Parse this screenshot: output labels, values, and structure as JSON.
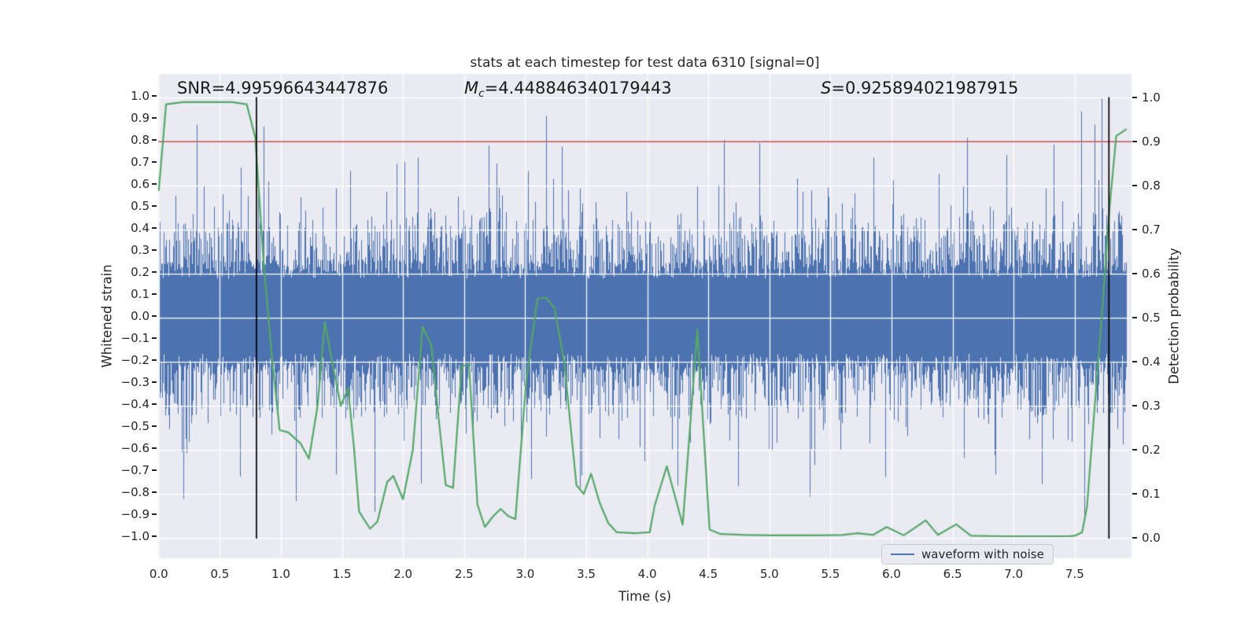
{
  "figure": {
    "title": "stats at each timestep for test data 6310 [signal=0]",
    "annotations": {
      "snr": "SNR=4.99596643447876",
      "mc_symbol": "M",
      "mc_sub": "c",
      "mc_value": "=4.448846340179443",
      "s_symbol": "S",
      "s_value": "=0.925894021987915"
    },
    "legend": {
      "label": "waveform with noise"
    }
  },
  "chart_data": {
    "type": "line",
    "title": "stats at each timestep for test data 6310 [signal=0]",
    "xlabel": "Time (s)",
    "ylabel_left": "Whitened strain",
    "ylabel_right": "Detection probability",
    "xlim": [
      -0.005,
      7.965
    ],
    "ylim_left": [
      -1.1,
      1.1
    ],
    "ylim_right": [
      -0.046,
      1.054
    ],
    "background": "#eaeaf2",
    "grid": {
      "color": "#ffffff",
      "x_step_s": 0.5,
      "y_right_step": 0.1
    },
    "xticks": [
      {
        "v": 0.0,
        "label": "0.0"
      },
      {
        "v": 0.5,
        "label": "0.5"
      },
      {
        "v": 1.0,
        "label": "1.0"
      },
      {
        "v": 1.5,
        "label": "1.5"
      },
      {
        "v": 2.0,
        "label": "2.0"
      },
      {
        "v": 2.5,
        "label": "2.5"
      },
      {
        "v": 3.0,
        "label": "3.0"
      },
      {
        "v": 3.5,
        "label": "3.5"
      },
      {
        "v": 4.0,
        "label": "4.0"
      },
      {
        "v": 4.5,
        "label": "4.5"
      },
      {
        "v": 5.0,
        "label": "5.0"
      },
      {
        "v": 5.5,
        "label": "5.5"
      },
      {
        "v": 6.0,
        "label": "6.0"
      },
      {
        "v": 6.5,
        "label": "6.5"
      },
      {
        "v": 7.0,
        "label": "7.0"
      },
      {
        "v": 7.5,
        "label": "7.5"
      }
    ],
    "yticks_left": [
      {
        "v": 1.0,
        "label": "1.0"
      },
      {
        "v": 0.9,
        "label": "0.9"
      },
      {
        "v": 0.8,
        "label": "0.8"
      },
      {
        "v": 0.7,
        "label": "0.7"
      },
      {
        "v": 0.6,
        "label": "0.6"
      },
      {
        "v": 0.5,
        "label": "0.5"
      },
      {
        "v": 0.4,
        "label": "0.4"
      },
      {
        "v": 0.3,
        "label": "0.3"
      },
      {
        "v": 0.2,
        "label": "0.2"
      },
      {
        "v": 0.1,
        "label": "0.1"
      },
      {
        "v": 0.0,
        "label": "0.0"
      },
      {
        "v": -0.1,
        "label": "−0.1"
      },
      {
        "v": -0.2,
        "label": "−0.2"
      },
      {
        "v": -0.3,
        "label": "−0.3"
      },
      {
        "v": -0.4,
        "label": "−0.4"
      },
      {
        "v": -0.5,
        "label": "−0.5"
      },
      {
        "v": -0.6,
        "label": "−0.6"
      },
      {
        "v": -0.7,
        "label": "−0.7"
      },
      {
        "v": -0.8,
        "label": "−0.8"
      },
      {
        "v": -0.9,
        "label": "−0.9"
      },
      {
        "v": -1.0,
        "label": "−1.0"
      }
    ],
    "yticks_right": [
      {
        "v": 1.0,
        "label": "1.0"
      },
      {
        "v": 0.9,
        "label": "0.9"
      },
      {
        "v": 0.8,
        "label": "0.8"
      },
      {
        "v": 0.7,
        "label": "0.7"
      },
      {
        "v": 0.6,
        "label": "0.6"
      },
      {
        "v": 0.5,
        "label": "0.5"
      },
      {
        "v": 0.4,
        "label": "0.4"
      },
      {
        "v": 0.3,
        "label": "0.3"
      },
      {
        "v": 0.2,
        "label": "0.2"
      },
      {
        "v": 0.1,
        "label": "0.1"
      },
      {
        "v": 0.0,
        "label": "0.0"
      }
    ],
    "threshold_line": {
      "axis": "right",
      "value": 0.9,
      "color": "#c44e52"
    },
    "vlines": {
      "x": [
        0.8,
        7.78
      ],
      "color": "#000000",
      "span_right_axis": [
        0.0,
        1.0
      ]
    },
    "annotations": {
      "SNR": 4.99596643447876,
      "Mc": 4.448846340179443,
      "S": 0.925894021987915
    },
    "series": [
      {
        "name": "waveform with noise",
        "type": "noise_band",
        "axis": "left",
        "color": "#4c72b0",
        "t_range": [
          0,
          7.92
        ],
        "core_halfwidth": [
          0.17,
          0.26
        ],
        "spike_model": {
          "p_small": 0.5,
          "small": 0.24,
          "p_med": 0.15,
          "med": 0.2,
          "p_big": 0.02,
          "big_min": 0.12,
          "big_extra": 0.3
        },
        "seed": 11,
        "notable_spikes": [
          {
            "t": 0.31,
            "v": 0.87
          },
          {
            "t": 0.86,
            "v": 0.86
          },
          {
            "t": 1.12,
            "v": -0.84
          },
          {
            "t": 1.45,
            "v": -0.72
          },
          {
            "t": 1.57,
            "v": 0.66
          },
          {
            "t": 2.12,
            "v": 0.72
          },
          {
            "t": 2.15,
            "v": -0.76
          },
          {
            "t": 3.05,
            "v": -0.74
          },
          {
            "t": 3.17,
            "v": 0.91
          },
          {
            "t": 3.3,
            "v": 0.77
          },
          {
            "t": 3.45,
            "v": -0.78
          },
          {
            "t": 4.25,
            "v": -0.77
          },
          {
            "t": 4.63,
            "v": 0.8
          },
          {
            "t": 5.33,
            "v": -0.82
          },
          {
            "t": 5.85,
            "v": 0.72
          },
          {
            "t": 5.95,
            "v": -0.73
          },
          {
            "t": 6.62,
            "v": 0.81
          },
          {
            "t": 6.85,
            "v": -0.72
          },
          {
            "t": 7.33,
            "v": 0.78
          },
          {
            "t": 7.55,
            "v": 0.93
          },
          {
            "t": 7.58,
            "v": -0.93
          },
          {
            "t": 7.66,
            "v": 0.87
          },
          {
            "t": 7.72,
            "v": 0.99
          }
        ]
      },
      {
        "name": "detection probability",
        "type": "line",
        "axis": "right",
        "color": "#55a868",
        "points": [
          [
            0.0,
            0.79
          ],
          [
            0.06,
            0.985
          ],
          [
            0.2,
            0.99
          ],
          [
            0.4,
            0.99
          ],
          [
            0.6,
            0.99
          ],
          [
            0.72,
            0.985
          ],
          [
            0.79,
            0.91
          ],
          [
            0.86,
            0.62
          ],
          [
            0.93,
            0.4
          ],
          [
            0.99,
            0.245
          ],
          [
            1.06,
            0.24
          ],
          [
            1.16,
            0.215
          ],
          [
            1.23,
            0.18
          ],
          [
            1.3,
            0.3
          ],
          [
            1.36,
            0.49
          ],
          [
            1.42,
            0.4
          ],
          [
            1.49,
            0.3
          ],
          [
            1.55,
            0.34
          ],
          [
            1.6,
            0.2
          ],
          [
            1.64,
            0.06
          ],
          [
            1.73,
            0.021
          ],
          [
            1.79,
            0.037
          ],
          [
            1.87,
            0.127
          ],
          [
            1.92,
            0.141
          ],
          [
            2.0,
            0.088
          ],
          [
            2.08,
            0.2
          ],
          [
            2.16,
            0.48
          ],
          [
            2.23,
            0.44
          ],
          [
            2.3,
            0.25
          ],
          [
            2.35,
            0.12
          ],
          [
            2.41,
            0.114
          ],
          [
            2.48,
            0.39
          ],
          [
            2.54,
            0.395
          ],
          [
            2.61,
            0.075
          ],
          [
            2.67,
            0.025
          ],
          [
            2.74,
            0.05
          ],
          [
            2.8,
            0.066
          ],
          [
            2.86,
            0.05
          ],
          [
            2.92,
            0.043
          ],
          [
            3.01,
            0.36
          ],
          [
            3.1,
            0.543
          ],
          [
            3.17,
            0.546
          ],
          [
            3.24,
            0.522
          ],
          [
            3.32,
            0.4
          ],
          [
            3.42,
            0.12
          ],
          [
            3.48,
            0.1
          ],
          [
            3.54,
            0.146
          ],
          [
            3.61,
            0.08
          ],
          [
            3.68,
            0.034
          ],
          [
            3.75,
            0.013
          ],
          [
            3.9,
            0.011
          ],
          [
            4.02,
            0.013
          ],
          [
            4.06,
            0.073
          ],
          [
            4.16,
            0.163
          ],
          [
            4.29,
            0.03
          ],
          [
            4.41,
            0.473
          ],
          [
            4.51,
            0.019
          ],
          [
            4.6,
            0.009
          ],
          [
            4.8,
            0.007
          ],
          [
            5.0,
            0.006
          ],
          [
            5.2,
            0.006
          ],
          [
            5.4,
            0.006
          ],
          [
            5.6,
            0.007
          ],
          [
            5.72,
            0.011
          ],
          [
            5.85,
            0.007
          ],
          [
            5.96,
            0.025
          ],
          [
            6.1,
            0.006
          ],
          [
            6.28,
            0.04
          ],
          [
            6.38,
            0.007
          ],
          [
            6.53,
            0.031
          ],
          [
            6.65,
            0.005
          ],
          [
            6.9,
            0.004
          ],
          [
            7.2,
            0.004
          ],
          [
            7.45,
            0.004
          ],
          [
            7.5,
            0.005
          ],
          [
            7.56,
            0.013
          ],
          [
            7.6,
            0.07
          ],
          [
            7.65,
            0.25
          ],
          [
            7.72,
            0.5
          ],
          [
            7.785,
            0.75
          ],
          [
            7.84,
            0.913
          ],
          [
            7.92,
            0.928
          ]
        ]
      }
    ],
    "legend": {
      "label": "waveform with noise",
      "position": "lower_right"
    }
  }
}
